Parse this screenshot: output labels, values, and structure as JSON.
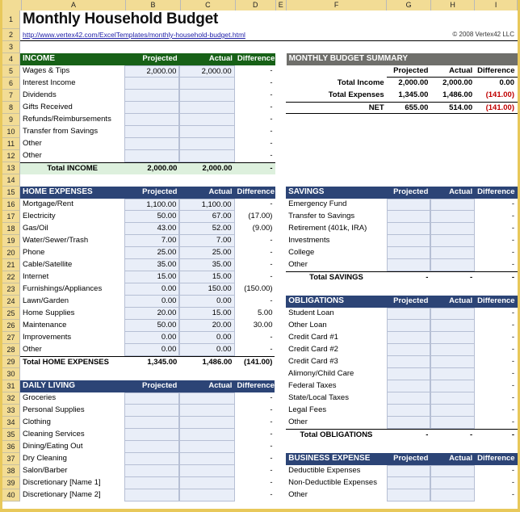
{
  "spreadsheet": {
    "column_headers": [
      "A",
      "B",
      "C",
      "D",
      "E",
      "F",
      "G",
      "H",
      "I"
    ],
    "row_numbers": [
      "1",
      "2",
      "3",
      "4",
      "5",
      "6",
      "7",
      "8",
      "9",
      "10",
      "11",
      "12",
      "13",
      "14",
      "15",
      "16",
      "17",
      "18",
      "19",
      "20",
      "21",
      "22",
      "23",
      "24",
      "25",
      "26",
      "27",
      "28",
      "29",
      "30",
      "31",
      "32",
      "33",
      "34",
      "35",
      "36",
      "37",
      "38",
      "39",
      "40"
    ]
  },
  "title": "Monthly Household Budget",
  "url": "http://www.vertex42.com/ExcelTemplates/monthly-household-budget.html",
  "copyright": "© 2008 Vertex42 LLC",
  "colors": {
    "income_header": "#176117",
    "section_header": "#2c4476",
    "summary_header": "#6f6f6b",
    "negative": "#c00000",
    "input_cell": "#e9eef8",
    "tab_gold": "#e8c85a"
  },
  "col_labels": {
    "projected": "Projected",
    "actual": "Actual",
    "difference": "Difference"
  },
  "income": {
    "header": "INCOME",
    "rows": [
      {
        "label": "Wages & Tips",
        "projected": "2,000.00",
        "actual": "2,000.00",
        "difference": "-"
      },
      {
        "label": "Interest Income",
        "projected": "",
        "actual": "",
        "difference": "-"
      },
      {
        "label": "Dividends",
        "projected": "",
        "actual": "",
        "difference": "-"
      },
      {
        "label": "Gifts Received",
        "projected": "",
        "actual": "",
        "difference": "-"
      },
      {
        "label": "Refunds/Reimbursements",
        "projected": "",
        "actual": "",
        "difference": "-"
      },
      {
        "label": "Transfer from Savings",
        "projected": "",
        "actual": "",
        "difference": "-"
      },
      {
        "label": "Other",
        "projected": "",
        "actual": "",
        "difference": "-"
      },
      {
        "label": "Other",
        "projected": "",
        "actual": "",
        "difference": "-"
      }
    ],
    "total": {
      "label": "Total INCOME",
      "projected": "2,000.00",
      "actual": "2,000.00",
      "difference": "-"
    }
  },
  "home_expenses": {
    "header": "HOME EXPENSES",
    "rows": [
      {
        "label": "Mortgage/Rent",
        "projected": "1,100.00",
        "actual": "1,100.00",
        "difference": "-"
      },
      {
        "label": "Electricity",
        "projected": "50.00",
        "actual": "67.00",
        "difference": "(17.00)"
      },
      {
        "label": "Gas/Oil",
        "projected": "43.00",
        "actual": "52.00",
        "difference": "(9.00)"
      },
      {
        "label": "Water/Sewer/Trash",
        "projected": "7.00",
        "actual": "7.00",
        "difference": "-"
      },
      {
        "label": "Phone",
        "projected": "25.00",
        "actual": "25.00",
        "difference": "-"
      },
      {
        "label": "Cable/Satellite",
        "projected": "35.00",
        "actual": "35.00",
        "difference": "-"
      },
      {
        "label": "Internet",
        "projected": "15.00",
        "actual": "15.00",
        "difference": "-"
      },
      {
        "label": "Furnishings/Appliances",
        "projected": "0.00",
        "actual": "150.00",
        "difference": "(150.00)"
      },
      {
        "label": "Lawn/Garden",
        "projected": "0.00",
        "actual": "0.00",
        "difference": "-"
      },
      {
        "label": "Home Supplies",
        "projected": "20.00",
        "actual": "15.00",
        "difference": "5.00"
      },
      {
        "label": "Maintenance",
        "projected": "50.00",
        "actual": "20.00",
        "difference": "30.00"
      },
      {
        "label": "Improvements",
        "projected": "0.00",
        "actual": "0.00",
        "difference": "-"
      },
      {
        "label": "Other",
        "projected": "0.00",
        "actual": "0.00",
        "difference": "-"
      }
    ],
    "total": {
      "label": "Total HOME EXPENSES",
      "projected": "1,345.00",
      "actual": "1,486.00",
      "difference": "(141.00)"
    }
  },
  "daily_living": {
    "header": "DAILY LIVING",
    "rows": [
      {
        "label": "Groceries",
        "projected": "",
        "actual": "",
        "difference": "-"
      },
      {
        "label": "Personal Supplies",
        "projected": "",
        "actual": "",
        "difference": "-"
      },
      {
        "label": "Clothing",
        "projected": "",
        "actual": "",
        "difference": "-"
      },
      {
        "label": "Cleaning Services",
        "projected": "",
        "actual": "",
        "difference": "-"
      },
      {
        "label": "Dining/Eating Out",
        "projected": "",
        "actual": "",
        "difference": "-"
      },
      {
        "label": "Dry Cleaning",
        "projected": "",
        "actual": "",
        "difference": "-"
      },
      {
        "label": "Salon/Barber",
        "projected": "",
        "actual": "",
        "difference": "-"
      },
      {
        "label": "Discretionary [Name 1]",
        "projected": "",
        "actual": "",
        "difference": "-"
      },
      {
        "label": "Discretionary [Name 2]",
        "projected": "",
        "actual": "",
        "difference": "-"
      }
    ]
  },
  "summary": {
    "header": "MONTHLY BUDGET SUMMARY",
    "rows": [
      {
        "label": "Total Income",
        "projected": "2,000.00",
        "actual": "2,000.00",
        "difference": "0.00",
        "negative": false
      },
      {
        "label": "Total Expenses",
        "projected": "1,345.00",
        "actual": "1,486.00",
        "difference": "(141.00)",
        "negative": true
      },
      {
        "label": "NET",
        "projected": "655.00",
        "actual": "514.00",
        "difference": "(141.00)",
        "negative": true
      }
    ]
  },
  "savings": {
    "header": "SAVINGS",
    "rows": [
      {
        "label": "Emergency Fund",
        "projected": "",
        "actual": "",
        "difference": "-"
      },
      {
        "label": "Transfer to Savings",
        "projected": "",
        "actual": "",
        "difference": "-"
      },
      {
        "label": "Retirement (401k, IRA)",
        "projected": "",
        "actual": "",
        "difference": "-"
      },
      {
        "label": "Investments",
        "projected": "",
        "actual": "",
        "difference": "-"
      },
      {
        "label": "College",
        "projected": "",
        "actual": "",
        "difference": "-"
      },
      {
        "label": "Other",
        "projected": "",
        "actual": "",
        "difference": "-"
      }
    ],
    "total": {
      "label": "Total SAVINGS",
      "projected": "-",
      "actual": "-",
      "difference": "-"
    }
  },
  "obligations": {
    "header": "OBLIGATIONS",
    "rows": [
      {
        "label": "Student Loan",
        "projected": "",
        "actual": "",
        "difference": "-"
      },
      {
        "label": "Other Loan",
        "projected": "",
        "actual": "",
        "difference": "-"
      },
      {
        "label": "Credit Card #1",
        "projected": "",
        "actual": "",
        "difference": "-"
      },
      {
        "label": "Credit Card #2",
        "projected": "",
        "actual": "",
        "difference": "-"
      },
      {
        "label": "Credit Card #3",
        "projected": "",
        "actual": "",
        "difference": "-"
      },
      {
        "label": "Alimony/Child Care",
        "projected": "",
        "actual": "",
        "difference": "-"
      },
      {
        "label": "Federal Taxes",
        "projected": "",
        "actual": "",
        "difference": "-"
      },
      {
        "label": "State/Local Taxes",
        "projected": "",
        "actual": "",
        "difference": "-"
      },
      {
        "label": "Legal Fees",
        "projected": "",
        "actual": "",
        "difference": "-"
      },
      {
        "label": "Other",
        "projected": "",
        "actual": "",
        "difference": "-"
      }
    ],
    "total": {
      "label": "Total OBLIGATIONS",
      "projected": "-",
      "actual": "-",
      "difference": "-"
    }
  },
  "business_expense": {
    "header": "BUSINESS EXPENSE",
    "rows": [
      {
        "label": "Deductible Expenses",
        "projected": "",
        "actual": "",
        "difference": "-"
      },
      {
        "label": "Non-Deductible Expenses",
        "projected": "",
        "actual": "",
        "difference": "-"
      },
      {
        "label": "Other",
        "projected": "",
        "actual": "",
        "difference": "-"
      }
    ]
  }
}
